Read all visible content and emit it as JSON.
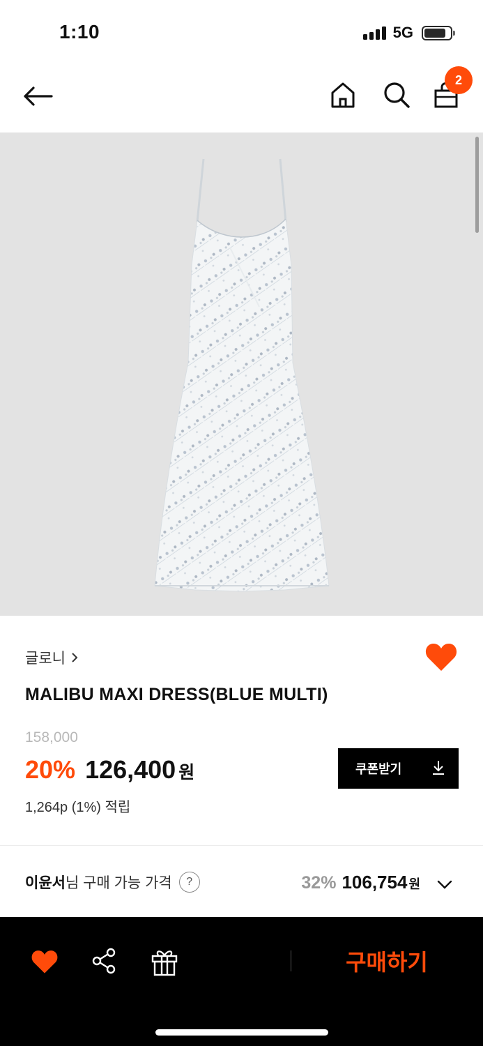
{
  "status_bar": {
    "time": "1:10",
    "network": "5G"
  },
  "nav": {
    "cart_count": "2"
  },
  "product": {
    "brand": "글로니",
    "name": "MALIBU MAXI DRESS(BLUE MULTI)",
    "original_price": "158,000",
    "discount": "20%",
    "sale_price": "126,400",
    "currency": "원",
    "points": "1,264p (1%) 적립",
    "coupon_label": "쿠폰받기"
  },
  "member": {
    "name": "이윤서",
    "suffix": "님 구매 가능 가격",
    "help": "?",
    "discount": "32%",
    "price": "106,754",
    "currency": "원"
  },
  "bottom_bar": {
    "buy_label": "구매하기"
  },
  "colors": {
    "accent": "#ff4b0a",
    "image_bg": "#e3e3e3"
  },
  "icons": [
    "back-arrow-icon",
    "home-icon",
    "search-icon",
    "shopping-bag-icon",
    "heart-icon",
    "share-icon",
    "gift-icon",
    "download-icon",
    "chevron-down-icon",
    "help-icon"
  ]
}
